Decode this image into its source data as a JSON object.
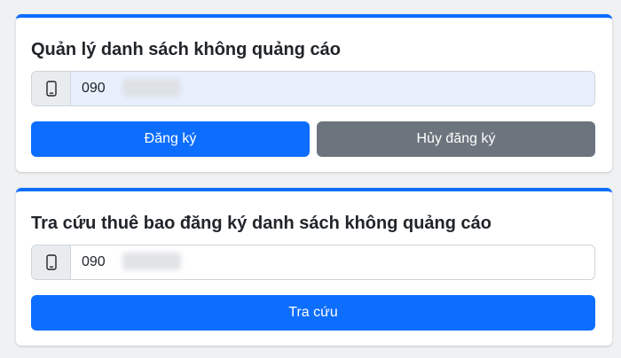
{
  "register_section": {
    "title": "Quản lý danh sách không quảng cáo",
    "phone_value": "090",
    "phone_icon": "mobile-phone-icon",
    "register_label": "Đăng ký",
    "unregister_label": "Hủy đăng ký"
  },
  "lookup_section": {
    "title": "Tra cứu thuê bao đăng ký danh sách không quảng cáo",
    "phone_value": "090",
    "phone_icon": "mobile-phone-icon",
    "lookup_label": "Tra cứu"
  },
  "colors": {
    "primary": "#0d6efd",
    "secondary": "#6c757d",
    "autofill_background": "#e8f0fe"
  }
}
